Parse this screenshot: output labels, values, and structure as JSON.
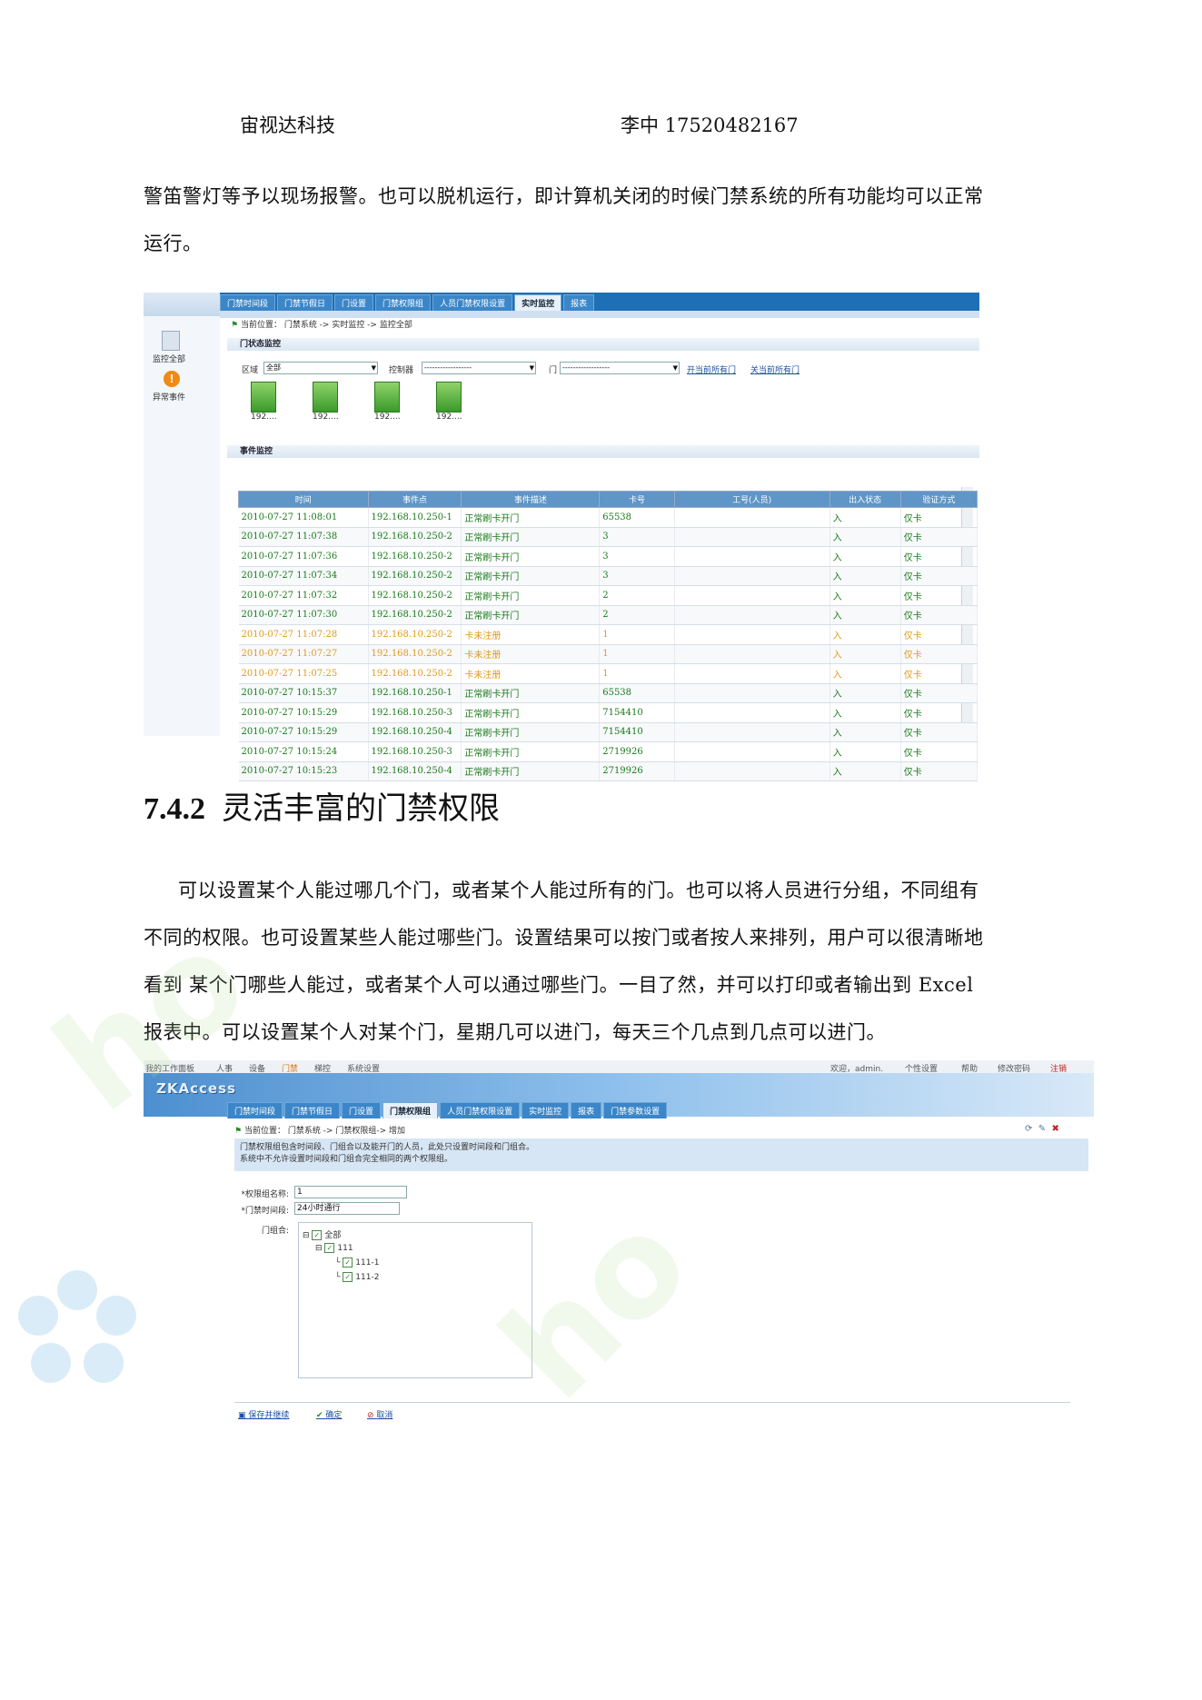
{
  "header": {
    "company": "宙视达科技",
    "contact": "李中  17520482167"
  },
  "intro_text_line1": "警笛警灯等予以现场报警。也可以脱机运行，即计算机关闭的时候门禁系统的所有功能均可以正常",
  "intro_text_line2": "运行。",
  "screenshot1": {
    "tabs": [
      "门禁时间段",
      "门禁节假日",
      "门设置",
      "门禁权限组",
      "人员门禁权限设置",
      "实时监控",
      "报表"
    ],
    "active_tab": "实时监控",
    "breadcrumb": "当前位置： 门禁系统 -> 实时监控 -> 监控全部",
    "side_items": [
      "监控全部",
      "异常事件"
    ],
    "door_section_title": "门状态监控",
    "filter_area_label": "区域",
    "filter_area_value": "全部",
    "filter_controller_label": "控制器",
    "filter_controller_value": "------------------",
    "filter_door_label": "门",
    "filter_door_value": "------------------",
    "link_open_all": "开当前所有门",
    "link_close_all": "关当前所有门",
    "doors": [
      "192....",
      "192....",
      "192....",
      "192...."
    ],
    "event_section_title": "事件监控",
    "columns": [
      "时间",
      "事件点",
      "事件描述",
      "卡号",
      "工号(人员)",
      "出入状态",
      "验证方式"
    ],
    "rows": [
      [
        "2010-07-27 11:08:01",
        "192.168.10.250-1",
        "正常刷卡开门",
        "65538",
        "",
        "入",
        "仅卡",
        "normal"
      ],
      [
        "2010-07-27 11:07:38",
        "192.168.10.250-2",
        "正常刷卡开门",
        "3",
        "",
        "入",
        "仅卡",
        "normal"
      ],
      [
        "2010-07-27 11:07:36",
        "192.168.10.250-2",
        "正常刷卡开门",
        "3",
        "",
        "入",
        "仅卡",
        "normal"
      ],
      [
        "2010-07-27 11:07:34",
        "192.168.10.250-2",
        "正常刷卡开门",
        "3",
        "",
        "入",
        "仅卡",
        "normal"
      ],
      [
        "2010-07-27 11:07:32",
        "192.168.10.250-2",
        "正常刷卡开门",
        "2",
        "",
        "入",
        "仅卡",
        "normal"
      ],
      [
        "2010-07-27 11:07:30",
        "192.168.10.250-2",
        "正常刷卡开门",
        "2",
        "",
        "入",
        "仅卡",
        "normal"
      ],
      [
        "2010-07-27 11:07:28",
        "192.168.10.250-2",
        "卡未注册",
        "1",
        "",
        "入",
        "仅卡",
        "warn"
      ],
      [
        "2010-07-27 11:07:27",
        "192.168.10.250-2",
        "卡未注册",
        "1",
        "",
        "入",
        "仅卡",
        "warn"
      ],
      [
        "2010-07-27 11:07:25",
        "192.168.10.250-2",
        "卡未注册",
        "1",
        "",
        "入",
        "仅卡",
        "warn"
      ],
      [
        "2010-07-27 10:15:37",
        "192.168.10.250-1",
        "正常刷卡开门",
        "65538",
        "",
        "入",
        "仅卡",
        "normal"
      ],
      [
        "2010-07-27 10:15:29",
        "192.168.10.250-3",
        "正常刷卡开门",
        "7154410",
        "",
        "入",
        "仅卡",
        "normal"
      ],
      [
        "2010-07-27 10:15:29",
        "192.168.10.250-4",
        "正常刷卡开门",
        "7154410",
        "",
        "入",
        "仅卡",
        "normal"
      ],
      [
        "2010-07-27 10:15:24",
        "192.168.10.250-3",
        "正常刷卡开门",
        "2719926",
        "",
        "入",
        "仅卡",
        "normal"
      ],
      [
        "2010-07-27 10:15:23",
        "192.168.10.250-4",
        "正常刷卡开门",
        "2719926",
        "",
        "入",
        "仅卡",
        "normal"
      ]
    ]
  },
  "section_heading": {
    "number": "7.4.2",
    "title": "灵活丰富的门禁权限"
  },
  "body_lines": [
    "可以设置某个人能过哪几个门，或者某个人能过所有的门。也可以将人员进行分组，不同组有",
    "不同的权限。也可设置某些人能过哪些门。设置结果可以按门或者按人来排列，用户可以很清晰地",
    "看到 某个门哪些人能过，或者某个人可以通过哪些门。一目了然，并可以打印或者输出到 Excel",
    "报表中。可以设置某个人对某个门，星期几可以进门，每天三个几点到几点可以进门。"
  ],
  "screenshot2": {
    "top_menu": [
      "我的工作面板",
      "人事",
      "设备",
      "门禁",
      "梯控",
      "系统设置"
    ],
    "top_right": [
      "欢迎，admin.",
      "个性设置",
      "帮助",
      "修改密码",
      "注销"
    ],
    "logo": "ZKAccess",
    "tabs": [
      "门禁时间段",
      "门禁节假日",
      "门设置",
      "门禁权限组",
      "人员门禁权限设置",
      "实时监控",
      "报表",
      "门禁参数设置"
    ],
    "active_tab": "门禁权限组",
    "breadcrumb": "当前位置： 门禁系统 -> 门禁权限组-> 增加",
    "notice_line1": "门禁权限组包含时间段、门组合以及能开门的人员，此处只设置时间段和门组合。",
    "notice_line2": "系统中不允许设置时间段和门组合完全相同的两个权限组。",
    "name_label": "*权限组名称:",
    "name_value": "1",
    "period_label": "*门禁时间段:",
    "period_value": "24小时通行",
    "combo_label": "门组合:",
    "tree": [
      "全部",
      "111",
      "111-1",
      "111-2"
    ],
    "actions": [
      "保存并继续",
      "确定",
      "取消"
    ]
  }
}
